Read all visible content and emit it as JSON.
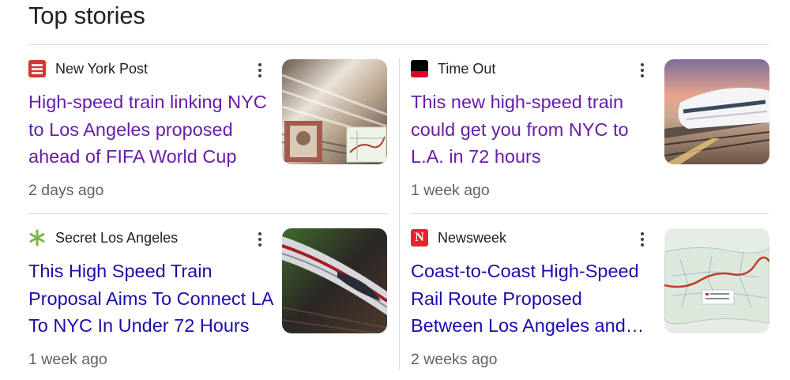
{
  "section": {
    "title": "Top stories"
  },
  "stories": [
    {
      "source": "New York Post",
      "headline": "High-speed train linking NYC to Los Angeles proposed ahead of FIFA World Cup",
      "age": "2 days ago",
      "visited": true,
      "favicon": "nypost-logo-icon",
      "thumbnail": "high-speed-train-blur-with-map"
    },
    {
      "source": "Time Out",
      "headline": "This new high-speed train could get you from NYC to L.A. in 72 hours",
      "age": "1 week ago",
      "visited": true,
      "favicon": "timeout-logo-icon",
      "thumbnail": "white-bullet-train-sunset"
    },
    {
      "source": "Secret Los Angeles",
      "headline": "This High Speed Train Proposal Aims To Connect LA To NYC In Under 72 Hours",
      "age": "1 week ago",
      "visited": false,
      "favicon": "secret-asterisk-icon",
      "thumbnail": "bullet-train-motion-blur"
    },
    {
      "source": "Newsweek",
      "headline": "Coast-to-Coast High-Speed Rail Route Proposed Between Los Angeles and…",
      "age": "2 weeks ago",
      "visited": false,
      "favicon": "newsweek-n-icon",
      "thumbnail": "us-rail-route-map"
    }
  ],
  "colors": {
    "visited_link": "#681da8",
    "link": "#1a0dab",
    "meta_text": "#5f6368",
    "divider": "#dadce0"
  }
}
